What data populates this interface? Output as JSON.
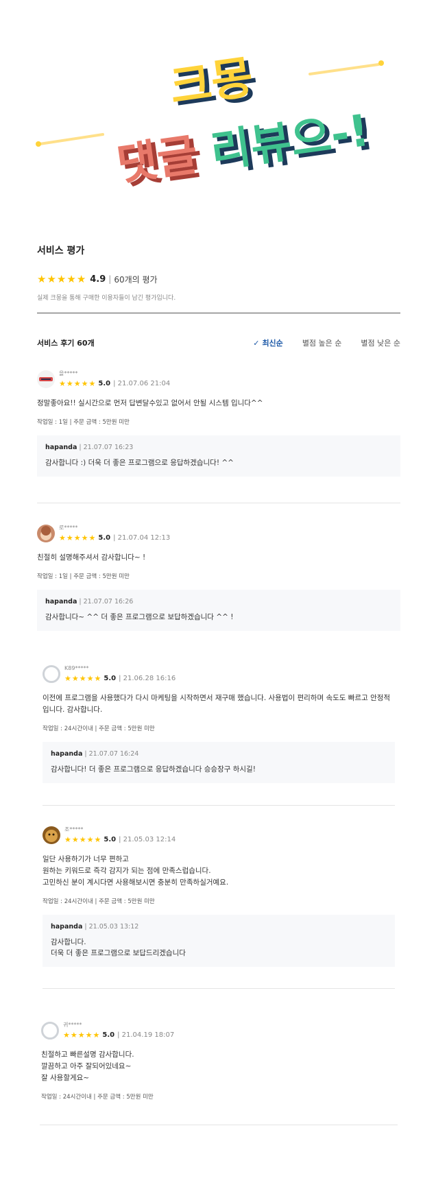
{
  "banner": {
    "line1": "크몽",
    "line2a": "댓글",
    "line2b": "리뷰으-!"
  },
  "rating": {
    "title": "서비스 평가",
    "score": "4.9",
    "count": "60개의 평가",
    "desc": "실제 크몽을 통해 구매한 이용자들이 남긴 평가입니다."
  },
  "reviews_header": {
    "title": "서비스 후기 60개",
    "sort_options": [
      "최신순",
      "별점 높은 순",
      "별점 낮은 순"
    ]
  },
  "colors": {
    "star": "#ffc400",
    "active_sort": "#1e5aa8",
    "banner_yellow": "#ffd33a",
    "banner_red": "#e36b5a",
    "banner_green": "#3fc28e",
    "banner_navy": "#1d3a5a"
  },
  "reviews": [
    {
      "user": "을*****",
      "score": "5.0",
      "date": "21.07.06 21:04",
      "text": "정말좋아요!! 실시간으로 먼저 답변달수있고 없어서 안될 시스템 입니다^^",
      "info": "작업일 : 1일 | 주문 금액 : 5만원 미만",
      "reply_name": "hapanda",
      "reply_date": "21.07.07 16:23",
      "reply_text": "감사합니다 :) 더욱 더 좋은 프로그램으로 응답하겠습니다! ^^"
    },
    {
      "user": "로*****",
      "score": "5.0",
      "date": "21.07.04 12:13",
      "text": "친절히 설명해주셔서 감사합니다~ !",
      "info": "작업일 : 1일 | 주문 금액 : 5만원 미만",
      "reply_name": "hapanda",
      "reply_date": "21.07.07 16:26",
      "reply_text": "감사합니다~ ^^ 더 좋은 프로그램으로 보답하겠습니다 ^^ !"
    },
    {
      "user": "K89*****",
      "score": "5.0",
      "date": "21.06.28 16:16",
      "text": "이전에 프로그램을 사용했다가 다시 마케팅을 시작하면서 재구매 했습니다. 사용법이 편리하며 속도도 빠르고 안정적입니다. 감사합니다.",
      "info": "작업일 : 24시간이내 | 주문 금액 : 5만원 미만",
      "reply_name": "hapanda",
      "reply_date": "21.07.07 16:24",
      "reply_text": "감사합니다! 더 좋은 프로그램으로 응답하겠습니다 승승장구 하시길!"
    },
    {
      "user": "조*****",
      "score": "5.0",
      "date": "21.05.03 12:14",
      "text_lines": [
        "일단 사용하기가 너무 편하고",
        "원하는 키워드로 즉각 감지가 되는 점에 만족스럽습니다.",
        "고민하신 분이 계시다면 사용해보시면 충분히 만족하실거예요."
      ],
      "info": "작업일 : 24시간이내 | 주문 금액 : 5만원 미만",
      "reply_name": "hapanda",
      "reply_date": "21.05.03 13:12",
      "reply_lines": [
        "감사합니다.",
        "더욱 더 좋은 프로그램으로 보답드리겠습니다"
      ]
    },
    {
      "user": "귀*****",
      "score": "5.0",
      "date": "21.04.19 18:07",
      "text_lines": [
        "친절하고 빠른설명 감사합니다.",
        "깔끔하고 아주 잘되어있네요~",
        "잘 사용할게요~"
      ],
      "info": "작업일 : 24시간이내 | 주문 금액 : 5만원 미만"
    }
  ]
}
